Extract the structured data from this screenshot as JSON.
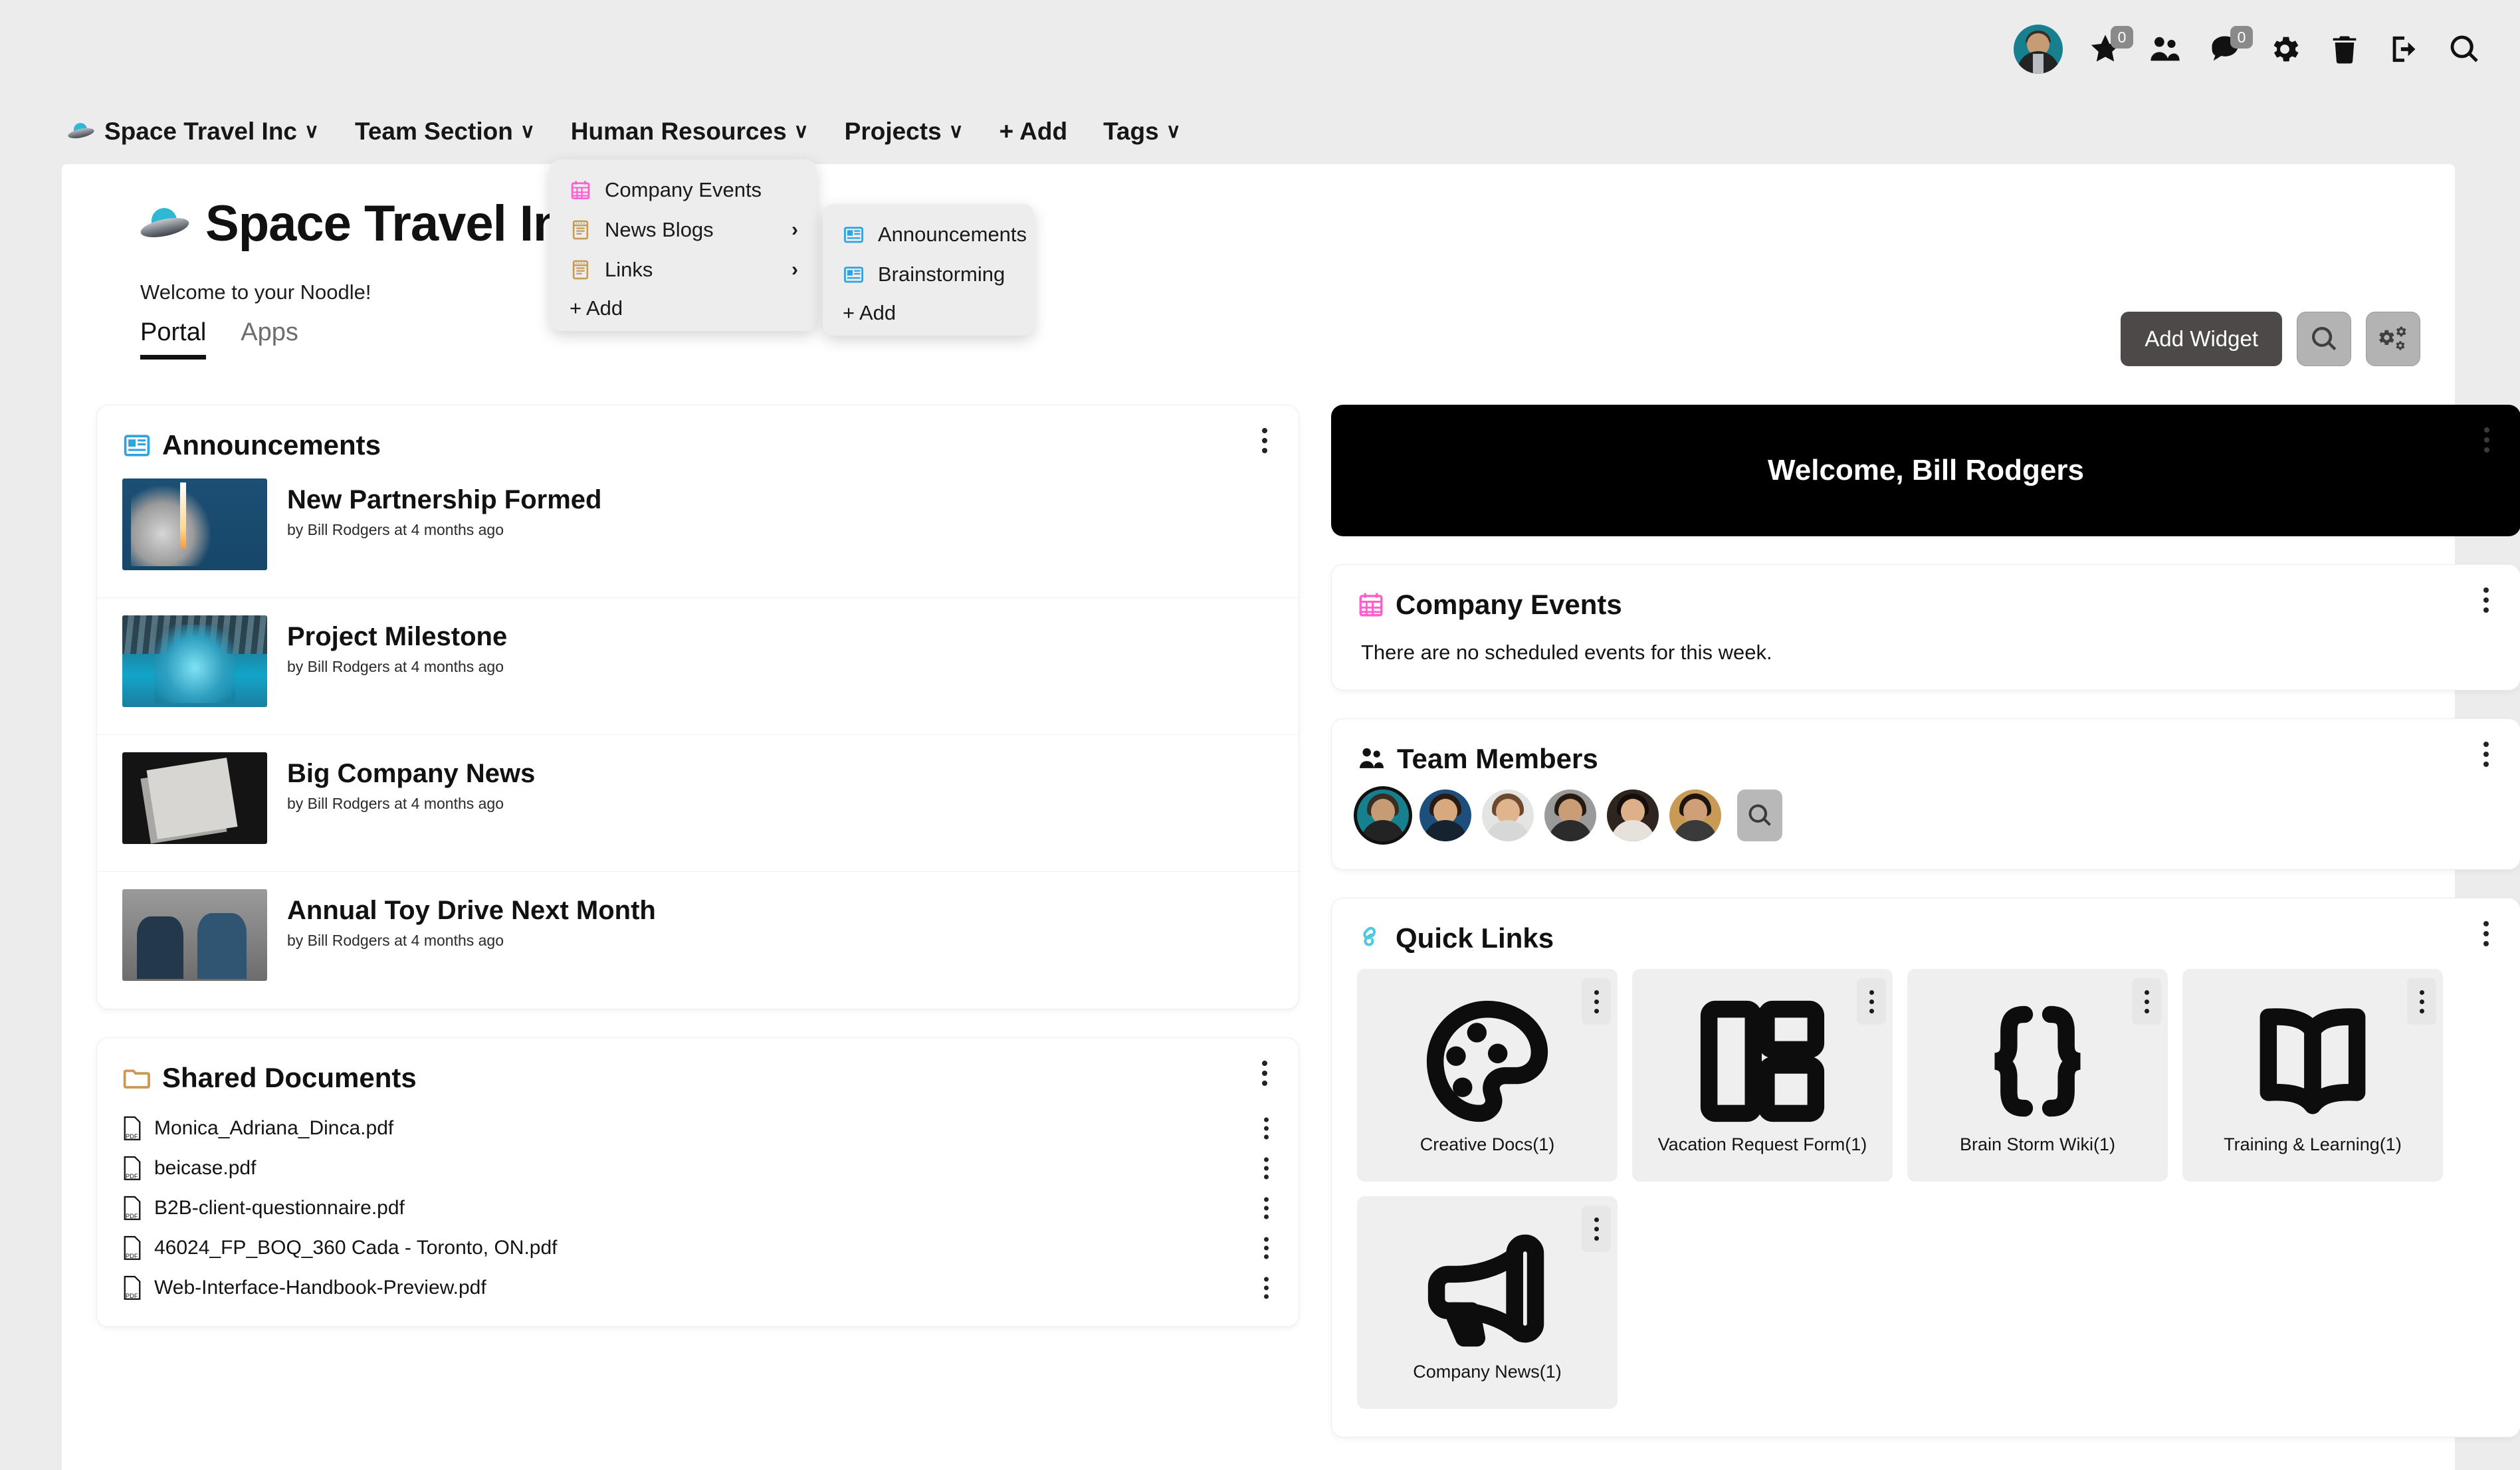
{
  "topbar": {
    "avatar_name": "user-avatar",
    "icons": [
      {
        "name": "star-icon",
        "badge": "0"
      },
      {
        "name": "people-icon",
        "badge": null
      },
      {
        "name": "chat-icon",
        "badge": "0"
      },
      {
        "name": "gear-icon",
        "badge": null
      },
      {
        "name": "trash-icon",
        "badge": null
      },
      {
        "name": "logout-icon",
        "badge": null
      },
      {
        "name": "search-icon",
        "badge": null
      }
    ]
  },
  "nav": {
    "items": [
      {
        "label": "Space Travel Inc",
        "caret": "∨",
        "has_logo": true
      },
      {
        "label": "Team Section",
        "caret": "∨"
      },
      {
        "label": "Human Resources",
        "caret": "∨"
      },
      {
        "label": "Projects",
        "caret": "∨"
      },
      {
        "label": "+ Add",
        "caret": ""
      },
      {
        "label": "Tags",
        "caret": "∨"
      }
    ]
  },
  "hr_menu": {
    "items": [
      {
        "label": "Company Events",
        "icon": "calendar-icon",
        "chevron": ""
      },
      {
        "label": "News Blogs",
        "icon": "notebook-icon",
        "chevron": "›"
      },
      {
        "label": "Links",
        "icon": "notebook-icon",
        "chevron": "›"
      }
    ],
    "add_label": "+ Add"
  },
  "sub_menu": {
    "items": [
      {
        "label": "Announcements",
        "icon": "newspaper-icon"
      },
      {
        "label": "Brainstorming",
        "icon": "newspaper-icon"
      }
    ],
    "add_label": "+ Add"
  },
  "page": {
    "title": "Space Travel Inc",
    "subtitle": "Welcome to your Noodle!",
    "tabs": [
      {
        "label": "Portal",
        "active": true
      },
      {
        "label": "Apps",
        "active": false
      }
    ],
    "toolbar": {
      "add_widget_label": "Add Widget",
      "search_icon": "search-icon",
      "settings_icon": "gears-icon"
    }
  },
  "announcements": {
    "title": "Announcements",
    "icon": "newspaper-icon",
    "items": [
      {
        "title": "New Partnership Formed",
        "meta": "by Bill Rodgers at 4 months ago",
        "thumb": "rocket-launch"
      },
      {
        "title": "Project Milestone",
        "meta": "by Bill Rodgers at 4 months ago",
        "thumb": "engine-blue"
      },
      {
        "title": "Big Company News",
        "meta": "by Bill Rodgers at 4 months ago",
        "thumb": "newspapers"
      },
      {
        "title": "Annual Toy Drive Next Month",
        "meta": "by Bill Rodgers at 4 months ago",
        "thumb": "children"
      }
    ]
  },
  "shared_documents": {
    "title": "Shared Documents",
    "icon": "folder-icon",
    "files": [
      "Monica_Adriana_Dinca.pdf",
      "beicase.pdf",
      "B2B-client-questionnaire.pdf",
      "46024_FP_BOQ_360 Cada - Toronto, ON.pdf",
      "Web-Interface-Handbook-Preview.pdf"
    ]
  },
  "banner": {
    "text": "Welcome, Bill Rodgers"
  },
  "company_events": {
    "title": "Company Events",
    "icon": "calendar-icon",
    "empty_text": "There are no scheduled events for this week."
  },
  "team_members": {
    "title": "Team Members",
    "icon": "people-icon",
    "avatars": [
      {
        "name": "avatar-bill-rodgers",
        "selected": true,
        "bg": "#17808f",
        "skin": "#c69c74",
        "hair": "#3a2d23",
        "body": "#232323"
      },
      {
        "name": "avatar-member-2",
        "selected": false,
        "bg": "#1d4f7c",
        "skin": "#d8a87f",
        "hair": "#2a1a12",
        "body": "#14232f"
      },
      {
        "name": "avatar-member-3",
        "selected": false,
        "bg": "#e4e4e2",
        "skin": "#e0b48d",
        "hair": "#6b4a2f",
        "body": "#d7d7d5"
      },
      {
        "name": "avatar-member-4",
        "selected": false,
        "bg": "#9a9a9a",
        "skin": "#c99d76",
        "hair": "#241a12",
        "body": "#2b2b2b"
      },
      {
        "name": "avatar-member-5",
        "selected": false,
        "bg": "#2e2420",
        "skin": "#ddb089",
        "hair": "#160e0a",
        "body": "#e6e1da"
      },
      {
        "name": "avatar-member-6",
        "selected": false,
        "bg": "#c79a55",
        "skin": "#cf9f78",
        "hair": "#1e1410",
        "body": "#3a3a3a"
      }
    ],
    "search_icon": "search-icon"
  },
  "quick_links": {
    "title": "Quick Links",
    "icon": "chain-link-icon",
    "tiles": [
      {
        "label": "Creative Docs(1)",
        "icon": "palette-icon"
      },
      {
        "label": "Vacation Request Form(1)",
        "icon": "layout-icon"
      },
      {
        "label": "Brain Storm Wiki(1)",
        "icon": "braces-icon"
      },
      {
        "label": "Training & Learning(1)",
        "icon": "open-book-icon"
      },
      {
        "label": "Company News(1)",
        "icon": "megaphone-icon"
      }
    ]
  },
  "colors": {
    "page_bg": "#ececec",
    "panel_bg": "#ffffff",
    "accent_blue": "#2fa3e0",
    "accent_pink": "#ff5fd0",
    "accent_gold": "#c79a55",
    "accent_cyan": "#4ec8df",
    "dark_button": "#4c4948"
  }
}
